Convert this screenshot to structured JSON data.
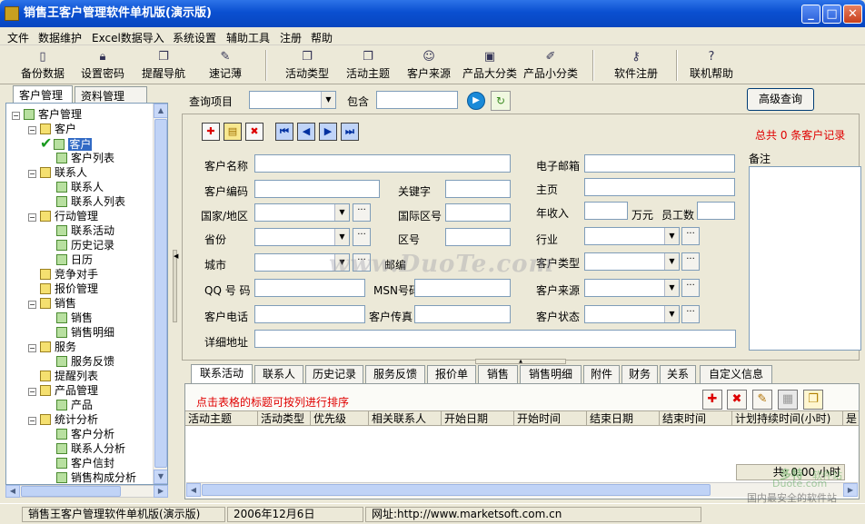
{
  "window": {
    "title": "销售王客户管理软件单机版(演示版)"
  },
  "menu": [
    "文件",
    "数据维护",
    "Excel数据导入",
    "系统设置",
    "辅助工具",
    "注册",
    "帮助"
  ],
  "toolbar": {
    "items": [
      {
        "label": "备份数据",
        "icon": "backup-icon"
      },
      {
        "label": "设置密码",
        "icon": "lock-icon"
      },
      {
        "label": "提醒导航",
        "icon": "windows-icon"
      },
      {
        "label": "速记薄",
        "icon": "notepad-icon"
      },
      {
        "label": "活动类型",
        "icon": "window-icon"
      },
      {
        "label": "活动主题",
        "icon": "window-icon"
      },
      {
        "label": "客户来源",
        "icon": "people-icon"
      },
      {
        "label": "产品大分类",
        "icon": "computer-icon"
      },
      {
        "label": "产品小分类",
        "icon": "pen-icon"
      },
      {
        "label": "软件注册",
        "icon": "key-icon"
      },
      {
        "label": "联机帮助",
        "icon": "help-icon"
      }
    ]
  },
  "left_tabs": [
    "客户管理",
    "资料管理"
  ],
  "tree": [
    {
      "label": "客户管理",
      "level": 0,
      "type": "root"
    },
    {
      "label": "客户",
      "level": 1,
      "type": "folder"
    },
    {
      "label": "客户",
      "level": 2,
      "type": "leaf",
      "selected": true
    },
    {
      "label": "客户列表",
      "level": 2,
      "type": "leaf"
    },
    {
      "label": "联系人",
      "level": 1,
      "type": "folder"
    },
    {
      "label": "联系人",
      "level": 2,
      "type": "leaf"
    },
    {
      "label": "联系人列表",
      "level": 2,
      "type": "leaf"
    },
    {
      "label": "行动管理",
      "level": 1,
      "type": "folder"
    },
    {
      "label": "联系活动",
      "level": 2,
      "type": "leaf"
    },
    {
      "label": "历史记录",
      "level": 2,
      "type": "leaf"
    },
    {
      "label": "日历",
      "level": 2,
      "type": "leaf"
    },
    {
      "label": "竞争对手",
      "level": 1,
      "type": "single"
    },
    {
      "label": "报价管理",
      "level": 1,
      "type": "single"
    },
    {
      "label": "销售",
      "level": 1,
      "type": "folder"
    },
    {
      "label": "销售",
      "level": 2,
      "type": "leaf"
    },
    {
      "label": "销售明细",
      "level": 2,
      "type": "leaf"
    },
    {
      "label": "服务",
      "level": 1,
      "type": "folder"
    },
    {
      "label": "服务反馈",
      "level": 2,
      "type": "leaf"
    },
    {
      "label": "提醒列表",
      "level": 1,
      "type": "single"
    },
    {
      "label": "产品管理",
      "level": 1,
      "type": "folder"
    },
    {
      "label": "产品",
      "level": 2,
      "type": "leaf"
    },
    {
      "label": "统计分析",
      "level": 1,
      "type": "folder"
    },
    {
      "label": "客户分析",
      "level": 2,
      "type": "leaf"
    },
    {
      "label": "联系人分析",
      "level": 2,
      "type": "leaf"
    },
    {
      "label": "客户信封",
      "level": 2,
      "type": "leaf"
    },
    {
      "label": "销售构成分析",
      "level": 2,
      "type": "leaf"
    }
  ],
  "query": {
    "item_label": "查询项目",
    "item_value": "",
    "contains_label": "包含",
    "contains_value": "",
    "advanced_button": "高级查询"
  },
  "record_count": "总共 0 条客户记录",
  "form": {
    "customer_name": "客户名称",
    "email": "电子邮箱",
    "notes": "备注",
    "customer_code": "客户编码",
    "keyword": "关键字",
    "homepage": "主页",
    "country": "国家/地区",
    "intl_code": "国际区号",
    "annual_income": "年收入",
    "wan_yuan": "万元",
    "employees": "员工数",
    "province": "省份",
    "area_code": "区号",
    "industry": "行业",
    "city": "城市",
    "postcode": "邮编",
    "customer_type": "客户类型",
    "qq": "QQ 号 码",
    "msn": "MSN号码",
    "customer_source": "客户来源",
    "phone": "客户电话",
    "fax": "客户传真",
    "customer_status": "客户状态",
    "address": "详细地址"
  },
  "detail_tabs": [
    "联系活动",
    "联系人",
    "历史记录",
    "服务反馈",
    "报价单",
    "销售",
    "销售明细",
    "附件",
    "财务",
    "关系",
    "自定义信息"
  ],
  "detail": {
    "hint": "点击表格的标题可按列进行排序",
    "columns": [
      "活动主题",
      "活动类型",
      "优先级",
      "相关联系人",
      "开始日期",
      "开始时间",
      "结束日期",
      "结束时间",
      "计划持续时间(小时)",
      "是"
    ],
    "total": "共: 0.00 小时"
  },
  "statusbar": {
    "product": "销售王客户管理软件单机版(演示版)",
    "date": "2006年12月6日",
    "url": "网址:http://www.marketsoft.com.cn"
  },
  "watermark": "www.DuoTe.com",
  "corner_watermark": [
    "多特",
    "软件站",
    "Duote.com",
    "国内最安全的软件站"
  ],
  "colors": {
    "titlebar": "#0a4fd0",
    "accent_red": "#e00000",
    "selection": "#316ac5"
  }
}
